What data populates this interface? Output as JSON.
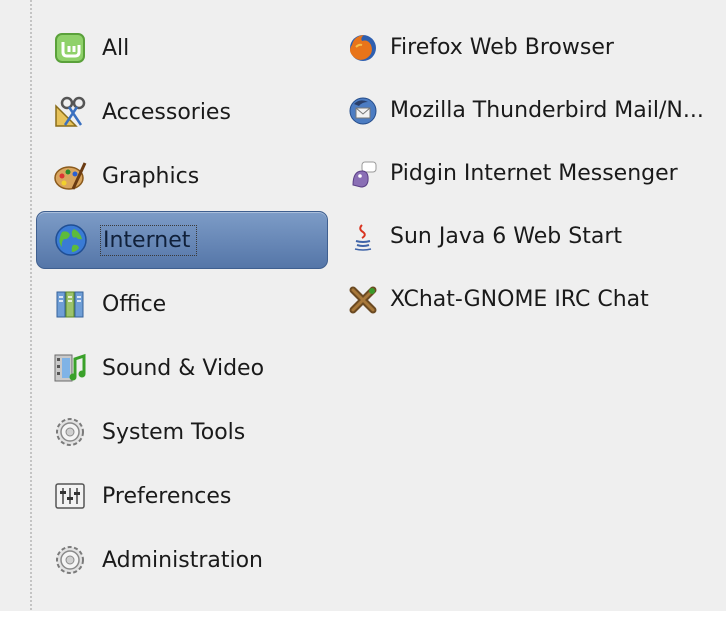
{
  "categories": [
    {
      "label": "All",
      "icon": "mint-all-icon"
    },
    {
      "label": "Accessories",
      "icon": "accessories-icon"
    },
    {
      "label": "Graphics",
      "icon": "graphics-palette-icon"
    },
    {
      "label": "Internet",
      "icon": "internet-globe-icon",
      "selected": true
    },
    {
      "label": "Office",
      "icon": "office-icon"
    },
    {
      "label": "Sound & Video",
      "icon": "sound-video-icon"
    },
    {
      "label": "System Tools",
      "icon": "system-tools-gear-icon"
    },
    {
      "label": "Preferences",
      "icon": "preferences-icon"
    },
    {
      "label": "Administration",
      "icon": "administration-gear-icon"
    }
  ],
  "apps": [
    {
      "label": "Firefox Web Browser",
      "icon": "firefox-icon"
    },
    {
      "label": "Mozilla Thunderbird Mail/N...",
      "icon": "thunderbird-icon"
    },
    {
      "label": "Pidgin Internet Messenger",
      "icon": "pidgin-icon"
    },
    {
      "label": "Sun Java 6 Web Start",
      "icon": "java-icon"
    },
    {
      "label": "XChat-GNOME IRC Chat",
      "icon": "xchat-icon"
    }
  ],
  "colors": {
    "selection": "#5a7bab",
    "background": "#efefef"
  }
}
